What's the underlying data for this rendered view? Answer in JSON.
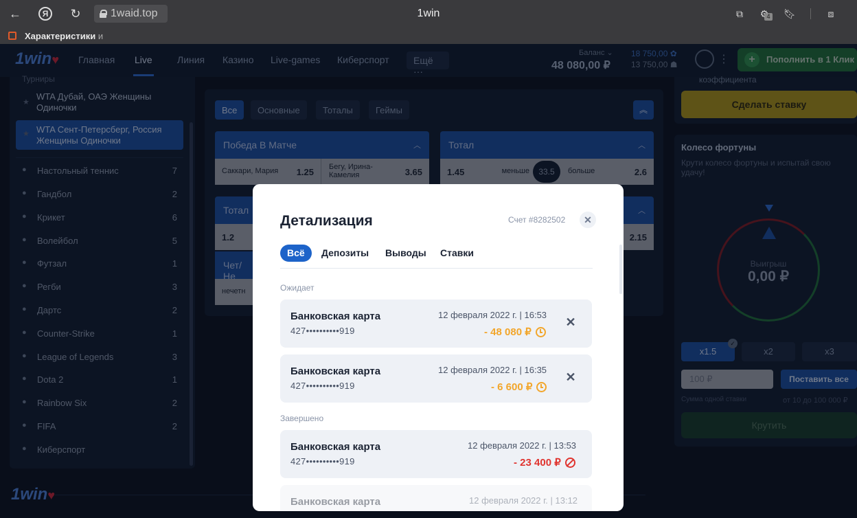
{
  "browser": {
    "url": "1waid.top",
    "page_title": "1win",
    "bookmark_label": "Характеристики",
    "bookmark_trail": "и",
    "extensions_badge": "4"
  },
  "header": {
    "logo": "1win",
    "nav": [
      "Главная",
      "Live",
      "Линия",
      "Казино",
      "Live-games",
      "Киберспорт"
    ],
    "more_label": "Ещё",
    "balance_label": "Баланс",
    "balance_value": "48 080,00 ₽",
    "balance_side_1": "18 750,00",
    "balance_side_2": "13 750,00",
    "deposit_label": "Пополнить в 1 Клик"
  },
  "sidebar": {
    "section_title": "Турниры",
    "tournaments": [
      "WTA Дубай, ОАЭ Женщины Одиночки",
      "WTA Сент-Петерсберг, Россия Женщины Одиночки"
    ],
    "sports": [
      {
        "label": "Настольный теннис",
        "count": "7"
      },
      {
        "label": "Гандбол",
        "count": "2"
      },
      {
        "label": "Крикет",
        "count": "6"
      },
      {
        "label": "Волейбол",
        "count": "5"
      },
      {
        "label": "Футзал",
        "count": "1"
      },
      {
        "label": "Регби",
        "count": "3"
      },
      {
        "label": "Дартс",
        "count": "2"
      },
      {
        "label": "Counter-Strike",
        "count": "1"
      },
      {
        "label": "League of Legends",
        "count": "3"
      },
      {
        "label": "Dota 2",
        "count": "1"
      },
      {
        "label": "Rainbow Six",
        "count": "2"
      },
      {
        "label": "FIFA",
        "count": "2"
      },
      {
        "label": "Киберспорт",
        "count": ""
      }
    ]
  },
  "markets": {
    "filters": [
      "Все",
      "Основные",
      "Тоталы",
      "Геймы"
    ],
    "match_winner": {
      "title": "Победа В Матче",
      "player1": "Саккари, Мария",
      "odd1": "1.25",
      "player2": "Бегу, Ирина-Камелия",
      "odd2": "3.65"
    },
    "total": {
      "title": "Тотал",
      "under_odd": "1.45",
      "under_label": "меньше",
      "line": "33.5",
      "over_label": "больше",
      "over_odd": "2.6"
    },
    "total2": {
      "title": "Тотал",
      "odd_left": "1.2",
      "odd_right": "2.15"
    },
    "odd_even": {
      "title": "Чет/Не",
      "value": "нечетн"
    }
  },
  "right_panel": {
    "coef_text": "коэффициента",
    "make_bet": "Сделать ставку",
    "wheel_title": "Колесо фортуны",
    "wheel_subtitle": "Крути колесо фортуны и испытай свою удачу!",
    "win_label": "Выигрыш",
    "win_value": "0,00 ₽",
    "multipliers": [
      "x1.5",
      "x2",
      "x3"
    ],
    "stake_placeholder": "100 ₽",
    "stake_all": "Поставить все",
    "hint_single": "Сумма одной ставки",
    "hint_range": "от 10 до 100 000 ₽",
    "spin": "Крутить"
  },
  "modal": {
    "title": "Детализация",
    "account": "Счет #8282502",
    "tabs": [
      "Всё",
      "Депозиты",
      "Выводы",
      "Ставки"
    ],
    "pending_label": "Ожидает",
    "done_label": "Завершено",
    "transactions": [
      {
        "method": "Банковская карта",
        "card": "427••••••••••919",
        "date": "12 февраля 2022 г. | 16:53",
        "amount": "- 48 080 ₽",
        "status": "pending"
      },
      {
        "method": "Банковская карта",
        "card": "427••••••••••919",
        "date": "12 февраля 2022 г. | 16:35",
        "amount": "- 6 600 ₽",
        "status": "pending"
      },
      {
        "method": "Банковская карта",
        "card": "427••••••••••919",
        "date": "12 февраля 2022 г. | 13:53",
        "amount": "- 23 400 ₽",
        "status": "cancelled"
      },
      {
        "method": "Банковская карта",
        "card": "",
        "date": "12 февраля 2022 г. | 13:12",
        "amount": "",
        "status": "cancelled"
      }
    ]
  },
  "colors": {
    "accent": "#1d63c9",
    "pending": "#f2a62b",
    "cancelled": "#e0342f"
  }
}
